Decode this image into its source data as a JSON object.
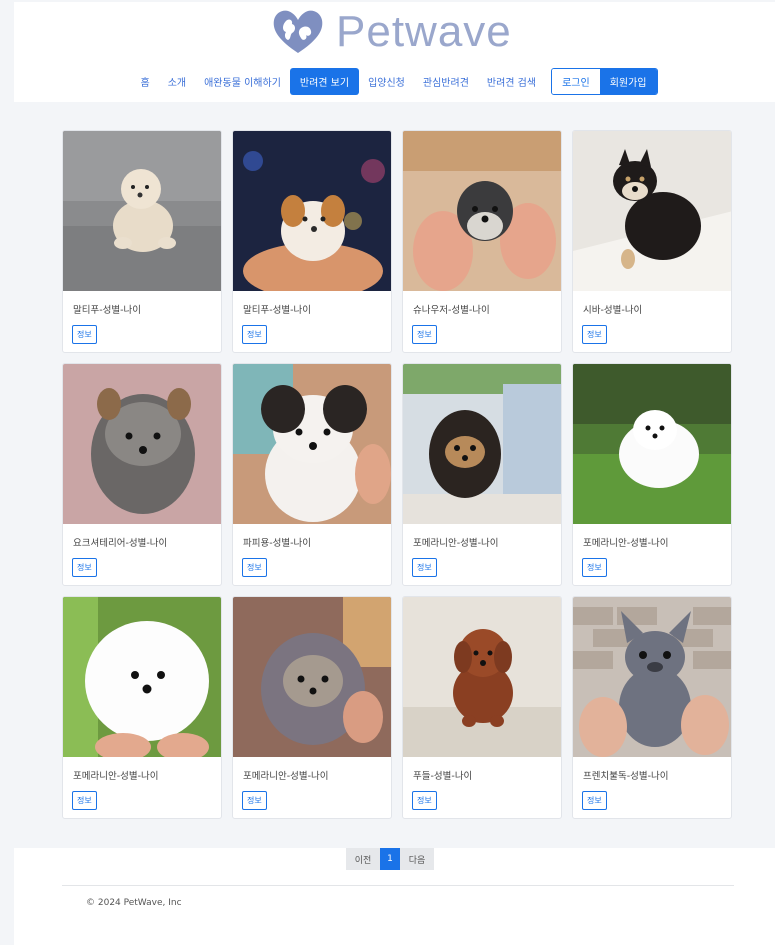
{
  "brand": {
    "name": "Petwave"
  },
  "nav": {
    "items": [
      "홈",
      "소개",
      "애완동물 이해하기",
      "반려견 보기",
      "입양신청",
      "관심반려견",
      "반려견 검색"
    ],
    "login": "로그인",
    "signup": "회원가입"
  },
  "cards": [
    {
      "title": "말티푸-성별-나이",
      "button": "정보"
    },
    {
      "title": "말티푸-성별-나이",
      "button": "정보"
    },
    {
      "title": "슈나우저-성별-나이",
      "button": "정보"
    },
    {
      "title": "시바-성별-나이",
      "button": "정보"
    },
    {
      "title": "요크셔테리어-성별-나이",
      "button": "정보"
    },
    {
      "title": "파피용-성별-나이",
      "button": "정보"
    },
    {
      "title": "포메라니안-성별-나이",
      "button": "정보"
    },
    {
      "title": "포메라니안-성별-나이",
      "button": "정보"
    },
    {
      "title": "포메라니안-성별-나이",
      "button": "정보"
    },
    {
      "title": "포메라니안-성별-나이",
      "button": "정보"
    },
    {
      "title": "푸들-성별-나이",
      "button": "정보"
    },
    {
      "title": "프렌치불독-성별-나이",
      "button": "정보"
    }
  ],
  "pagination": {
    "prev": "이전",
    "current": "1",
    "next": "다음"
  },
  "footer": {
    "copyright": "© 2024 PetWave, Inc"
  },
  "colors": {
    "accent": "#1a73e8",
    "logo": "#9aa7cc"
  }
}
